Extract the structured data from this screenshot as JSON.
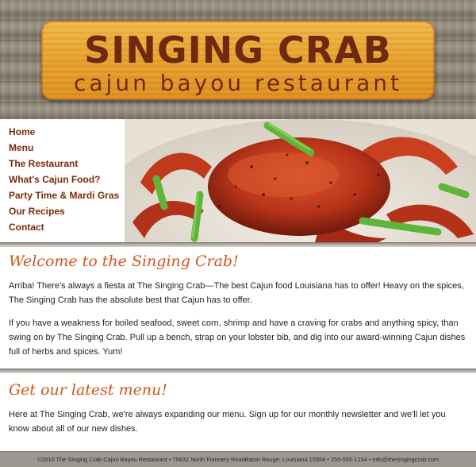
{
  "header": {
    "title": "SINGING CRAB",
    "subtitle": "cajun bayou restaurant"
  },
  "nav": {
    "items": [
      {
        "label": "Home"
      },
      {
        "label": "Menu"
      },
      {
        "label": "The Restaurant"
      },
      {
        "label": "What's Cajun Food?"
      },
      {
        "label": "Party Time & Mardi Gras"
      },
      {
        "label": "Our Recipes"
      },
      {
        "label": "Contact"
      }
    ]
  },
  "welcome": {
    "heading": "Welcome to the Singing Crab!",
    "p1": "Arriba! There's always a fiesta at The Singing Crab—The best Cajun food Louisiana has to offer! Heavy on the spices, The Singing Crab has the absolute best that Cajun has to offer.",
    "p2": "If you have a weakness for boiled seafood, sweet corn, shrimp and have a craving for crabs and anything spicy, than swing on by The Singing Crab. Pull up a bench, strap on your lobster bib, and dig into our award-winning Cajun dishes full of herbs and spices. Yum!"
  },
  "menu_section": {
    "heading": "Get our latest menu!",
    "p1": "Here at The Singing Crab, we're always expanding our menu. Sign up for our monthly newsletter and we'll let you know about all of our new dishes."
  },
  "footer": {
    "text": "©2010 The Singing Crab Cajun Bayou Restaurant • 75632 North Flannery RoadBaton Rouge, Louisiana 15558 • 255-555-1234 • info@thesingingcrab.com"
  },
  "colors": {
    "accent": "#d2561b",
    "nav_link": "#7a2a0c",
    "sign": "#e9a531"
  }
}
